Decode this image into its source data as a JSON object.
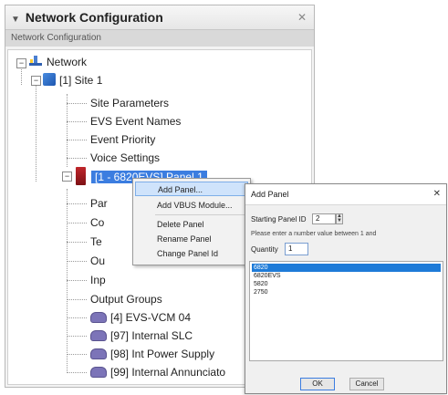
{
  "net_panel": {
    "title": "Network Configuration",
    "pin_glyph": "✕",
    "subtitle": "Network Configuration"
  },
  "tree": {
    "root": "Network",
    "site": "[1] Site 1",
    "site_children": [
      "Site Parameters",
      "EVS Event Names",
      "Event Priority",
      "Voice Settings"
    ],
    "panel": "[1 - 6820EVS] Panel 1",
    "panel_children_truncated": [
      "Par",
      "Co",
      "Te",
      "Ou",
      "Inp"
    ],
    "output_groups": "Output Groups",
    "devices": [
      "[4] EVS-VCM 04",
      "[97] Internal SLC",
      "[98] Int Power Supply",
      "[99] Internal Annunciato"
    ]
  },
  "context_menu": {
    "items": [
      "Add Panel...",
      "Add VBUS Module...",
      "Delete Panel",
      "Rename Panel",
      "Change Panel Id"
    ]
  },
  "dialog": {
    "title": "Add Panel",
    "close_glyph": "✕",
    "starting_panel_label": "Starting Panel ID",
    "starting_panel_value": "2",
    "hint": "Please enter a number value between 1 and",
    "quantity_label": "Quantity",
    "quantity_value": "1",
    "options": [
      "6820",
      "6820EVS",
      "5820",
      "2750"
    ],
    "selected_option": "6820",
    "ok_label": "OK",
    "cancel_label": "Cancel"
  }
}
